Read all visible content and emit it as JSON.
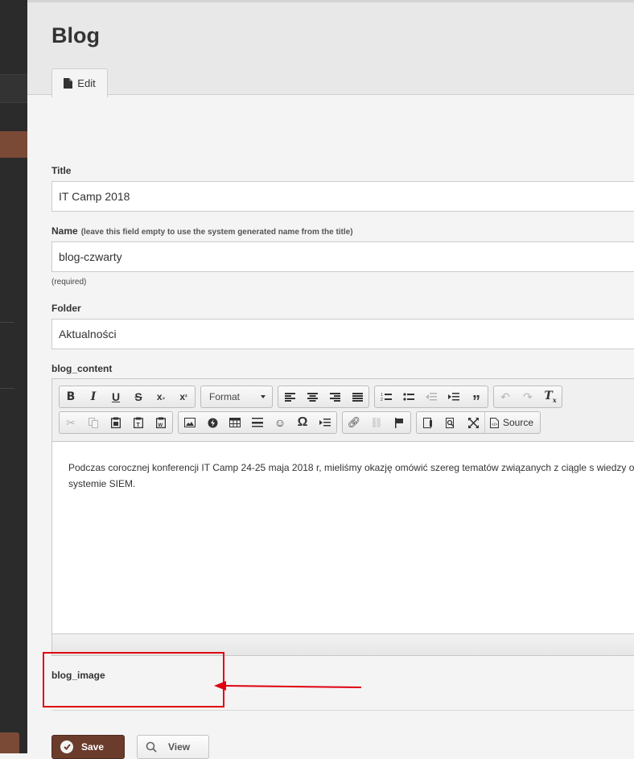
{
  "page": {
    "title": "Blog"
  },
  "tabs": [
    {
      "label": "Edit",
      "icon": "document-icon"
    }
  ],
  "form": {
    "title_label": "Title",
    "title_value": "IT Camp 2018",
    "name_label": "Name",
    "name_hint": "(leave this field empty to use the system generated name from the title)",
    "name_value": "blog-czwarty",
    "name_required": "(required)",
    "folder_label": "Folder",
    "folder_value": "Aktualności",
    "content_label": "blog_content",
    "content_text": "Podczas corocznej konferencji IT Camp 24-25 maja 2018 r, mieliśmy okazję omówić szereg tematów związanych z ciągle s wiedzy o systemie SIEM.",
    "image_label": "blog_image"
  },
  "editor": {
    "format_label": "Format",
    "source_label": "Source"
  },
  "actions": {
    "save_label": "Save",
    "view_label": "View"
  },
  "colors": {
    "accent": "#6b3b2c",
    "annotation": "#e0000f",
    "sidebar": "#2b2b2b"
  }
}
